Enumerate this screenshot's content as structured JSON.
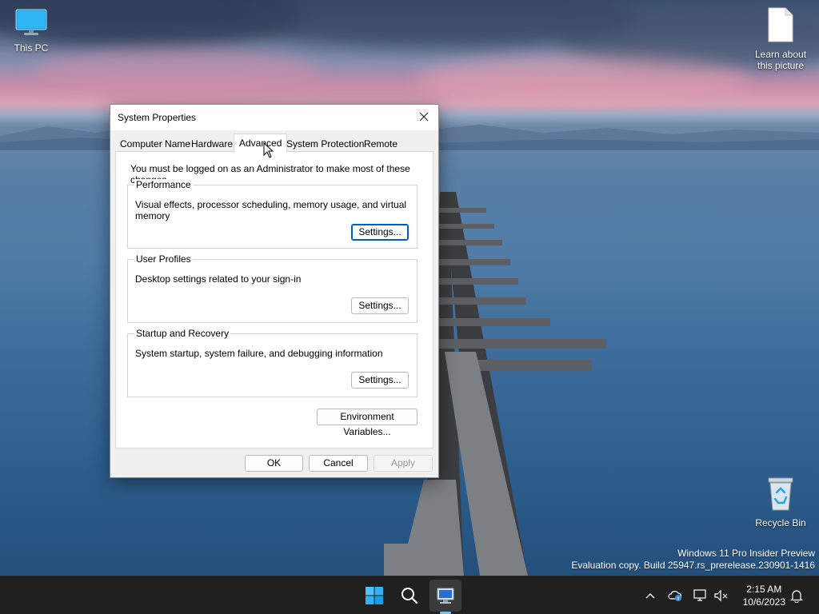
{
  "desktop": {
    "icons": [
      {
        "label": "This PC"
      },
      {
        "label": "Learn about this picture"
      },
      {
        "label": "Recycle Bin"
      }
    ],
    "watermark": {
      "line1": "Windows 11 Pro Insider Preview",
      "line2": "Evaluation copy. Build 25947.rs_prerelease.230901-1416"
    }
  },
  "dialog": {
    "title": "System Properties",
    "tabs": [
      {
        "label": "Computer Name"
      },
      {
        "label": "Hardware"
      },
      {
        "label": "Advanced",
        "active": true
      },
      {
        "label": "System Protection"
      },
      {
        "label": "Remote"
      }
    ],
    "admin_note": "You must be logged on as an Administrator to make most of these changes.",
    "groups": [
      {
        "label": "Performance",
        "description": "Visual effects, processor scheduling, memory usage, and virtual memory",
        "button": "Settings..."
      },
      {
        "label": "User Profiles",
        "description": "Desktop settings related to your sign-in",
        "button": "Settings..."
      },
      {
        "label": "Startup and Recovery",
        "description": "System startup, system failure, and debugging information",
        "button": "Settings..."
      }
    ],
    "env_button": "Environment Variables...",
    "footer": {
      "ok": "OK",
      "cancel": "Cancel",
      "apply": "Apply"
    }
  },
  "taskbar": {
    "clock": {
      "time": "2:15 AM",
      "date": "10/6/2023"
    },
    "accent": "#60cdff"
  }
}
